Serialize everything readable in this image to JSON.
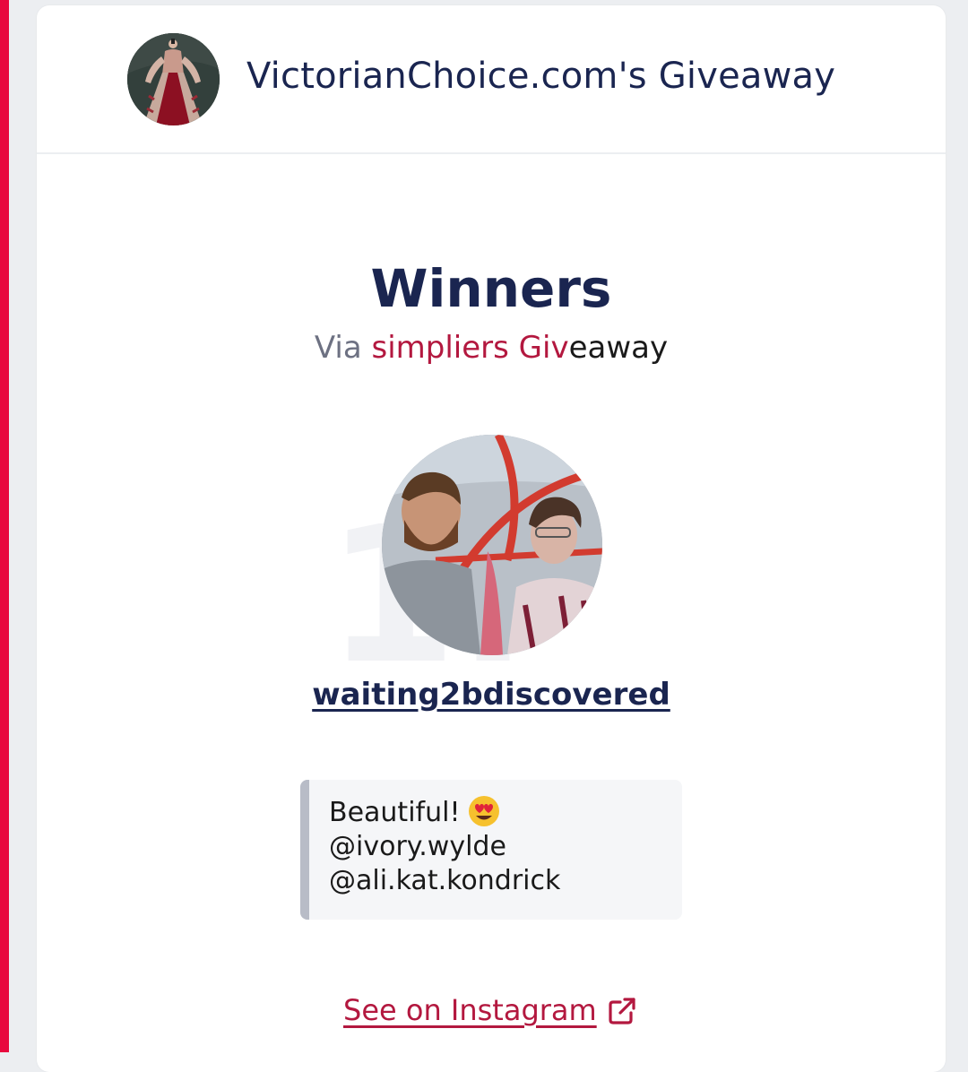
{
  "header": {
    "title": "VictorianChoice.com's Giveaway",
    "avatar_icon": "victorian-dress-avatar"
  },
  "results": {
    "title": "Winners",
    "via_prefix": "Via",
    "via_brand": "simpliers Giv",
    "via_tail": "eaway",
    "brand_color": "#b3183f"
  },
  "winner": {
    "rank": "1.",
    "username": "waiting2bdiscovered",
    "avatar_icon": "winner-photo-avatar",
    "comment": {
      "line1": "Beautiful!",
      "emoji": "heart-eyes-emoji",
      "line2": "@ivory.wylde",
      "line3": "@ali.kat.kondrick"
    }
  },
  "footer": {
    "instagram_link": "See on Instagram",
    "link_icon": "external-link-icon"
  },
  "colors": {
    "accent": "#e8083e",
    "heading": "#1a2550"
  }
}
